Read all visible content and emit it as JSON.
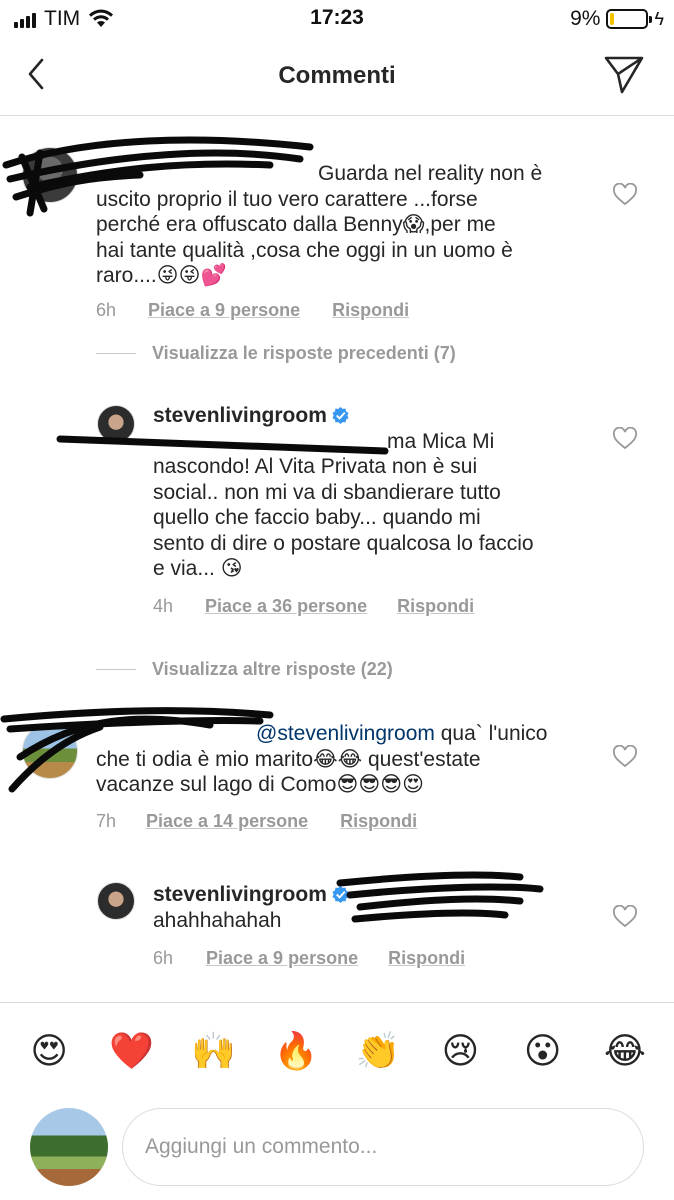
{
  "status_bar": {
    "carrier": "TIM",
    "time": "17:23",
    "battery_pct": "9%",
    "battery_level": 0.09,
    "battery_color": "#f2c200"
  },
  "header": {
    "title": "Commenti",
    "back_icon": "chevron-left-icon",
    "send_icon": "paper-plane-icon"
  },
  "comments": [
    {
      "username_visible": "",
      "text": "Guarda nel reality non è uscito proprio il tuo vero carattere ...forse perché era offuscato dalla Benny",
      "text_lines": [
        "Guarda nel reality non è",
        "uscito proprio il tuo vero carattere ...forse",
        "perché era offuscato dalla Benny😱,per me",
        "hai tante qualità ,cosa che oggi in un uomo è",
        "raro....😜😜💕"
      ],
      "time": "6h",
      "likes": "Piace a 9 persone",
      "reply": "Rispondi"
    },
    {
      "view_more": "Visualizza le risposte precedenti (7)"
    },
    {
      "username": "stevenlivingroom",
      "verified": true,
      "text_lines": [
        "ma Mica Mi",
        "nascondo! Al Vita Privata non è sui",
        "social.. non mi va di sbandierare tutto",
        "quello che faccio baby... quando mi",
        "sento di dire o postare qualcosa lo faccio",
        "e via... 😘"
      ],
      "time": "4h",
      "likes": "Piace a 36 persone",
      "reply": "Rispondi"
    },
    {
      "view_more": "Visualizza altre risposte (22)"
    },
    {
      "mention": "@stevenlivingroom",
      "text_lines": [
        "qua` l'unico",
        "che ti odia è mio marito😂😂 quest'estate",
        "vacanze sul lago di Como😎😎😎😍"
      ],
      "time": "7h",
      "likes": "Piace a 14 persone",
      "reply": "Rispondi"
    },
    {
      "username": "stevenlivingroom",
      "verified": true,
      "text_lines": [
        "ahahhahahah"
      ],
      "time": "6h",
      "likes": "Piace a 9 persone",
      "reply": "Rispondi"
    }
  ],
  "emoji_bar": [
    "😍",
    "❤️",
    "🙌",
    "🔥",
    "👏",
    "😢",
    "😮",
    "😂"
  ],
  "input": {
    "placeholder": "Aggiungi un commento..."
  },
  "colors": {
    "text": "#262626",
    "secondary": "#999999",
    "divider": "#dbdbdb",
    "verified": "#3897f0"
  }
}
